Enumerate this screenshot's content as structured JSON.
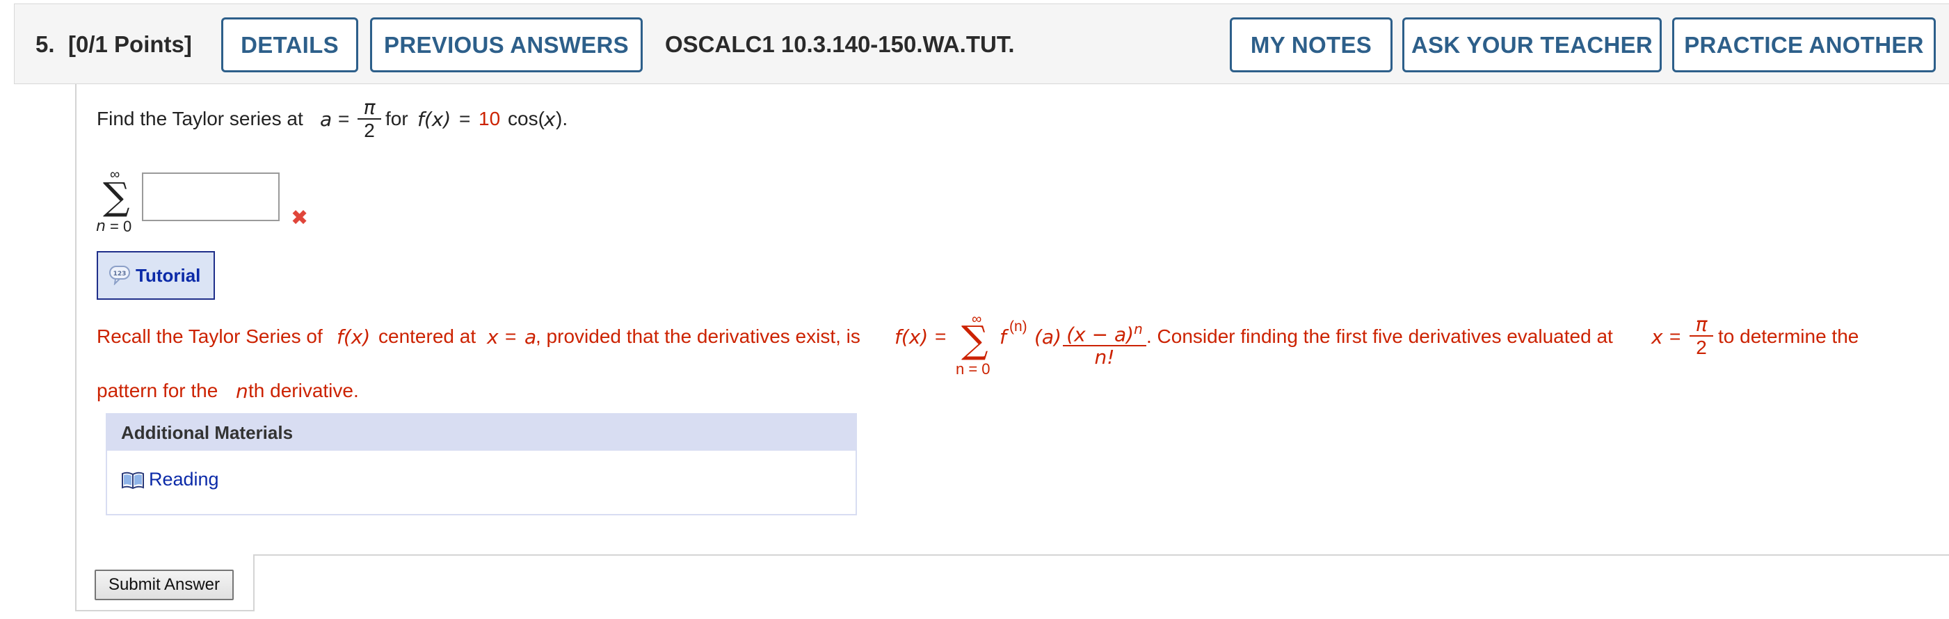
{
  "header": {
    "question_number": "5.",
    "points": "[0/1 Points]",
    "details_label": "DETAILS",
    "previous_answers_label": "PREVIOUS ANSWERS",
    "assignment_code": "OSCALC1 10.3.140-150.WA.TUT.",
    "my_notes_label": "MY NOTES",
    "ask_teacher_label": "ASK YOUR TEACHER",
    "practice_another_label": "PRACTICE ANOTHER"
  },
  "question": {
    "prompt_start": "Find the Taylor series at",
    "var_a": "a",
    "equals": "=",
    "pi": "π",
    "two": "2",
    "for_text": "for",
    "f_of_x": "f(x)",
    "coefficient": "10",
    "cos_text": "cos(",
    "x": "x",
    "close": ").",
    "sum_upper": "∞",
    "sum_lower_var": "n",
    "sum_lower_rest": "= 0",
    "answer_value": "",
    "answer_status": "incorrect",
    "incorrect_mark": "✖"
  },
  "tutorial": {
    "icon_text": "1 2 3",
    "label": "Tutorial"
  },
  "hint": {
    "part1": "Recall the Taylor Series of",
    "fx1": "f(x)",
    "part2": "centered at",
    "x_eq": "x",
    "eq": "=",
    "a1": "a",
    "part3": ", provided that the derivatives exist, is",
    "fx2": "f(x)",
    "eq2": "=",
    "sum_upper": "∞",
    "sum_lower": "n = 0",
    "f_base": "f",
    "f_sup": "(n)",
    "f_arg": "(a)",
    "frac_num": "(x − a)",
    "frac_num_exp": "n",
    "frac_den": "n!",
    "part4": ". Consider finding the first five derivatives evaluated at",
    "x2": "x",
    "eq3": "=",
    "pi": "π",
    "two": "2",
    "part5": "to determine the",
    "line2_start": "pattern for the",
    "nth": "n",
    "line2_end": "th derivative."
  },
  "additional_materials": {
    "title": "Additional Materials",
    "reading_label": "Reading"
  },
  "submit": {
    "label": "Submit Answer"
  },
  "colors": {
    "accent": "#2d5f8a",
    "hint_red": "#cc2200",
    "link_blue": "#0b2aa8"
  }
}
